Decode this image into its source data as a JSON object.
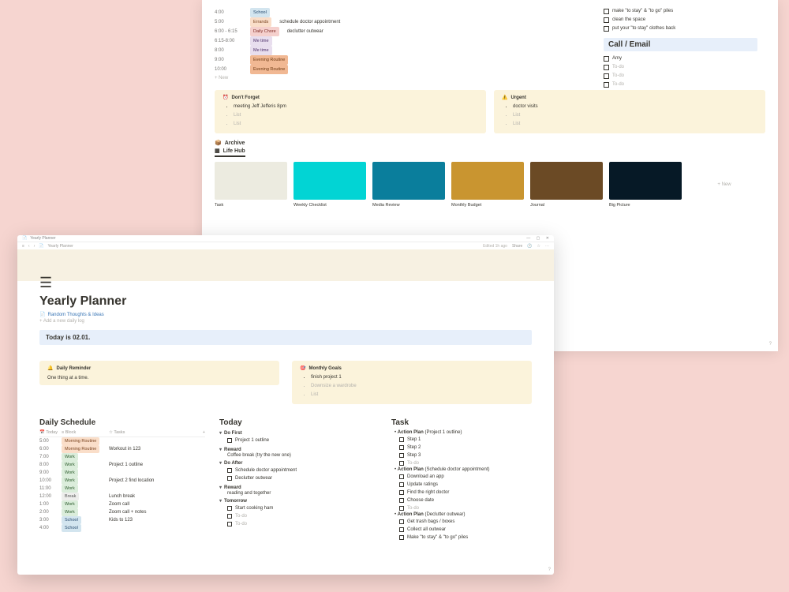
{
  "back": {
    "schedule": [
      {
        "time": "4:00",
        "block": "School",
        "blockClass": "tag-school",
        "note": ""
      },
      {
        "time": "5:00",
        "block": "Errands",
        "blockClass": "tag-errands",
        "note": "schedule doctor appointment"
      },
      {
        "time": "6:00 - 6:15",
        "block": "Daily Chore",
        "blockClass": "tag-chores",
        "note": "declutter outwear"
      },
      {
        "time": "6:15-8:00",
        "block": "Me time",
        "blockClass": "tag-me",
        "note": ""
      },
      {
        "time": "8:00",
        "block": "Me time",
        "blockClass": "tag-me",
        "note": ""
      },
      {
        "time": "9:00",
        "block": "Evening Routine",
        "blockClass": "tag-evening",
        "note": ""
      },
      {
        "time": "10:00",
        "block": "Evening Routine",
        "blockClass": "tag-evening",
        "note": ""
      }
    ],
    "add_new": "+ New",
    "right_tasks": [
      "make \"to stay\" & \"to go\" piles",
      "clean the space",
      "put your \"to stay\" clothes back"
    ],
    "call_email_title": "Call / Email",
    "call_email_items": [
      "Amy",
      "To-do",
      "To-do",
      "To-do"
    ],
    "dont_forget": {
      "title": "Don't Forget",
      "items": [
        "meeting Jeff Jefferis 8pm",
        "List",
        "List"
      ]
    },
    "urgent": {
      "title": "Urgent",
      "items": [
        "doctor visits",
        "List",
        "List"
      ]
    },
    "archive": "Archive",
    "lifehub": "Life Hub",
    "swatches": [
      {
        "label": "Task",
        "color": "#ecebe0"
      },
      {
        "label": "Weekly Checklist",
        "color": "#02d4d4"
      },
      {
        "label": "Media Review",
        "color": "#0a7e9c"
      },
      {
        "label": "Monthly Budget",
        "color": "#c99530"
      },
      {
        "label": "Journal",
        "color": "#6b4a25"
      },
      {
        "label": "Big Picture",
        "color": "#061926"
      }
    ],
    "swatch_new": "+ New"
  },
  "front": {
    "titlebar": {
      "filename": "Yearly Planner"
    },
    "toolbar": {
      "breadcrumb": "Yearly Planner",
      "edited": "Edited 1h ago",
      "share": "Share"
    },
    "icon_glyph": "☰",
    "page_title": "Yearly Planner",
    "subpage": "Random Thoughts & Ideas",
    "subpage_add": "+  Add a new daily log",
    "today_banner": "Today is 02.01.",
    "daily_reminder": {
      "title": "Daily Reminder",
      "body": "One thing at a time."
    },
    "monthly_goals": {
      "title": "Monthly Goals",
      "items": [
        "finish project 1",
        "Downsize a wardrobe",
        "List"
      ]
    },
    "ds_title": "Daily Schedule",
    "ds_headers": {
      "time": "Today",
      "block": "Block",
      "fav": "Tasks"
    },
    "ds_rows": [
      {
        "time": "",
        "block": "",
        "blockClass": "",
        "text": ""
      },
      {
        "time": "5:00",
        "block": "Morning Routine",
        "blockClass": "tag-morning",
        "text": ""
      },
      {
        "time": "6:00",
        "block": "Morning Routine",
        "blockClass": "tag-morning",
        "text": "Workout in 123"
      },
      {
        "time": "7:00",
        "block": "Work",
        "blockClass": "tag-work",
        "text": ""
      },
      {
        "time": "8:00",
        "block": "Work",
        "blockClass": "tag-work",
        "text": "Project 1 outline"
      },
      {
        "time": "9:00",
        "block": "Work",
        "blockClass": "tag-work",
        "text": ""
      },
      {
        "time": "10:00",
        "block": "Work",
        "blockClass": "tag-work",
        "text": "Project 2 find location"
      },
      {
        "time": "11:00",
        "block": "Work",
        "blockClass": "tag-work",
        "text": ""
      },
      {
        "time": "12:00",
        "block": "Break",
        "blockClass": "tag-break",
        "text": "Lunch break"
      },
      {
        "time": "1:00",
        "block": "Work",
        "blockClass": "tag-work",
        "text": "Zoom call"
      },
      {
        "time": "2:00",
        "block": "Work",
        "blockClass": "tag-work",
        "text": "Zoom call + notes"
      },
      {
        "time": "3:00",
        "block": "School",
        "blockClass": "tag-school",
        "text": "Kids to 123"
      },
      {
        "time": "4:00",
        "block": "School",
        "blockClass": "tag-school",
        "text": ""
      }
    ],
    "today_title": "Today",
    "today": {
      "do_first": {
        "title": "Do First",
        "items": [
          "Project 1 outline"
        ]
      },
      "reward1": {
        "title": "Reward",
        "body": "Coffee break (try the new one)"
      },
      "do_after": {
        "title": "Do After",
        "items": [
          "Schedule doctor appointment",
          "Declutter outwear"
        ]
      },
      "reward2": {
        "title": "Reward",
        "body": "reading and together"
      },
      "tomorrow": {
        "title": "Tomorrow",
        "items": [
          "Start cooking ham",
          "To-do",
          "To-do"
        ]
      }
    },
    "task_title": "Task",
    "task": {
      "ap1": {
        "title": "Action Plan (Project 1 outline)",
        "items": [
          "Step 1",
          "Step 2",
          "Step 3",
          "To-do"
        ]
      },
      "ap2": {
        "title": "Action Plan (Schedule doctor appointment)",
        "items": [
          "Download an app",
          "Update ratings",
          "Find the right doctor",
          "Choose date",
          "To-do"
        ]
      },
      "ap3": {
        "title": "Action Plan (Declutter outwear)",
        "items": [
          "Get trash bags / boxes",
          "Collect all outwear",
          "Make \"to stay\" & \"to go\" piles"
        ]
      }
    }
  }
}
